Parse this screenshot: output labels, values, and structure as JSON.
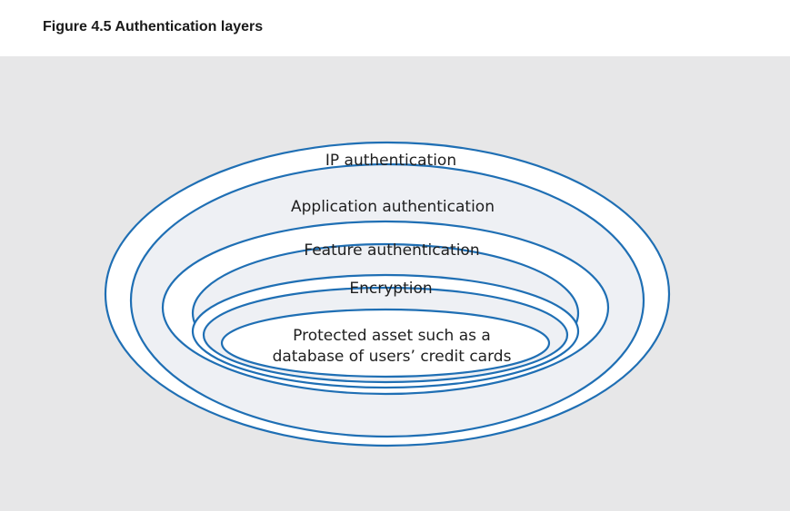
{
  "figure": {
    "title": "Figure 4.5 Authentication layers"
  },
  "colors": {
    "panel_background": "#e7e7e8",
    "ring_stroke": "#1f6fb4",
    "ring_fill_white": "#ffffff",
    "ring_fill_shaded": "#eef0f4"
  },
  "diagram": {
    "layers": [
      {
        "label": "IP authentication"
      },
      {
        "label": "Application authentication"
      },
      {
        "label": "Feature authentication"
      },
      {
        "label": "Encryption"
      }
    ],
    "core": {
      "line1": "Protected asset such as a",
      "line2": "database of users’ credit cards"
    }
  }
}
